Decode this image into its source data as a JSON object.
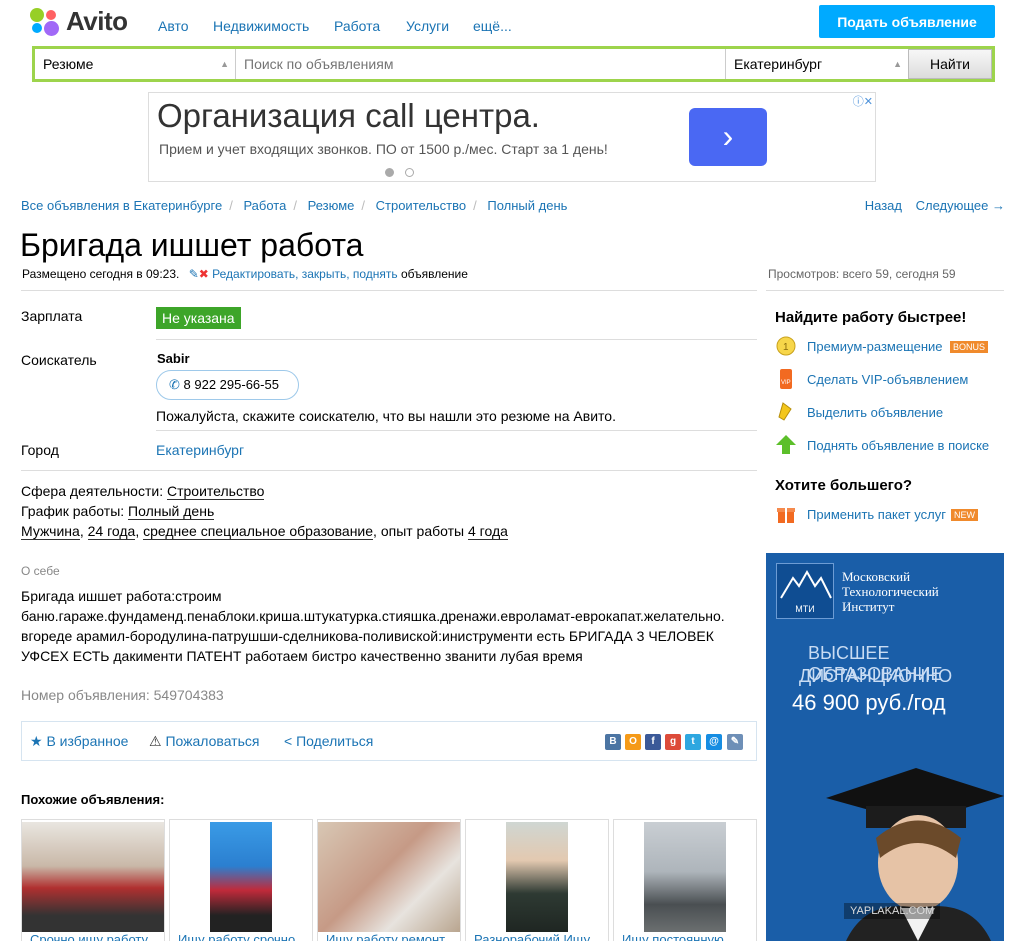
{
  "header": {
    "logo": "Avito",
    "nav": [
      "Авто",
      "Недвижимость",
      "Работа",
      "Услуги",
      "ещё..."
    ],
    "post_button": "Подать объявление"
  },
  "search": {
    "category": "Резюме",
    "placeholder": "Поиск по объявлениям",
    "city": "Екатеринбург",
    "button": "Найти"
  },
  "ad": {
    "title": "Организация call центра.",
    "subtitle": "Прием и учет входящих звонков. ПО от 1500 р./мес. Старт за 1 день!",
    "arrow": "›",
    "close": "ⓘ✕"
  },
  "breadcrumbs": [
    "Все объявления в Екатеринбурге",
    "Работа",
    "Резюме",
    "Строительство",
    "Полный день"
  ],
  "nav_links": {
    "back": "Назад",
    "next": "Следующее →"
  },
  "listing": {
    "title": "Бригада ишшет работа",
    "posted": "Размещено сегодня в 09:23.",
    "edit_links": "Редактировать, закрыть, поднять",
    "edit_suffix": "объявление",
    "views": "Просмотров: всего 59, сегодня 59",
    "salary_label": "Зарплата",
    "salary": "Не указана",
    "seeker_label": "Соискатель",
    "seeker_name": "Sabir",
    "phone": "8 922 295-66-55",
    "phone_note": "Пожалуйста, скажите соискателю, что вы нашли это резюме на Авито.",
    "city_label": "Город",
    "city": "Екатеринбург",
    "sphere_label": "Сфера деятельности:",
    "sphere": "Строительство",
    "schedule_label": "График работы:",
    "schedule": "Полный день",
    "gender": "Мужчина",
    "age": "24 года",
    "education": "среднее специальное образование",
    "exp_label": "опыт работы",
    "exp": "4 года",
    "about_label": "О себе",
    "about": "Бригада ишшет работа:строим баню.гараже.фундаменд.пенаблоки.криша.штукатурка.стияшка.дренажи.евроламат-еврокапат.желательно. вгореде арамил-бородулина-патрушши-сделникова-поливиской:иниструменти есть БРИГАДА 3 ЧЕЛОВЕК УФСЕХ ЕСТЬ дакименти ПАТЕНТ работаем бистро качественно званити лубая время",
    "ad_number": "Номер объявления: 549704383"
  },
  "actions": {
    "favorite": "В избранное",
    "complain": "Пожаловаться",
    "share": "Поделиться"
  },
  "similar": {
    "heading": "Похожие объявления:",
    "items": [
      "Срочно ищу работу",
      "Ищу работу срочно",
      "Ищу работу ремонт",
      "Разнорабочий Ищу",
      "Ищу постоянную"
    ]
  },
  "sidebar": {
    "heading1": "Найдите работу быстрее!",
    "items": [
      {
        "label": "Премиум-размещение",
        "badge": "BONUS"
      },
      {
        "label": "Сделать VIP-объявлением"
      },
      {
        "label": "Выделить объявление"
      },
      {
        "label": "Поднять объявление в поиске"
      }
    ],
    "heading2": "Хотите большего?",
    "package": "Применить пакет услуг",
    "package_badge": "NEW"
  },
  "banner": {
    "logo": "МТИ",
    "name1": "Московский",
    "name2": "Технологический",
    "name3": "Институт",
    "line1": "ВЫСШЕЕ ОБРАЗОВАНИЕ",
    "line2": "ДИСТАНЦИОННО",
    "price": "46 900 руб./год",
    "watermark": "YAPLAKAL.COM"
  },
  "colors": {
    "accent": "#00aaff",
    "link": "#1b74b4",
    "salary": "#3da529",
    "search_border": "#9dd44c",
    "banner": "#1a5ea8"
  }
}
